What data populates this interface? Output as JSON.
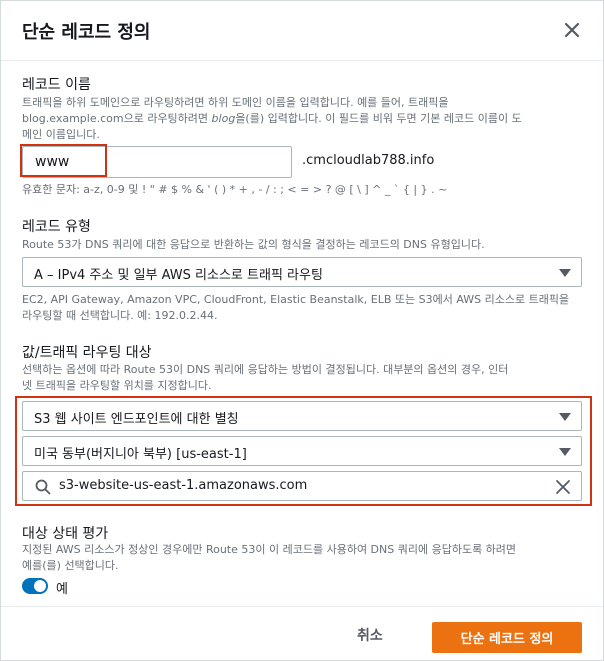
{
  "dialog": {
    "title": "단순 레코드 정의"
  },
  "record_name": {
    "label": "레코드 이름",
    "desc_line1": "트래픽을 하위 도메인으로 라우팅하려면 하위 도메인 이름을 입력합니다. 예를 들어, 트래픽을",
    "desc_line2_pre": "blog.example.com으로 라우팅하려면 ",
    "desc_line2_em": "blog",
    "desc_line2_post": "을(를) 입력합니다. 이 필드를 비워 두면 기본 레코드 이름이 도",
    "desc_line3": "메인 이름입니다.",
    "value": "www",
    "domain_suffix": ".cmcloudlab788.info",
    "valid_chars": "유효한 문자: a-z, 0-9 및 ! \" # $ % & ' ( ) * + , - / : ; < = > ? @ [ \\ ] ^ _ ` { | } . ~"
  },
  "record_type": {
    "label": "레코드 유형",
    "desc": "Route 53가 DNS 쿼리에 대한 응답으로 반환하는 값의 형식을 결정하는 레코드의 DNS 유형입니다.",
    "selected": "A – IPv4 주소 및 일부 AWS 리소스로 트래픽 라우팅",
    "hint_line1": "EC2, API Gateway, Amazon VPC, CloudFront, Elastic Beanstalk, ELB 또는 S3에서 AWS 리소스로 트래픽을",
    "hint_line2": "라우팅할 때 선택합니다. 예: 192.0.2.44."
  },
  "target": {
    "label": "값/트래픽 라우팅 대상",
    "desc_line1": "선택하는 옵션에 따라 Route 53이 DNS 쿼리에 응답하는 방법이 결정됩니다. 대부분의 옵션의 경우, 인터",
    "desc_line2": "넷 트래픽을 라우팅할 위치를 지정합니다.",
    "endpoint": "S3 웹 사이트 엔드포인트에 대한 별칭",
    "region": "미국 동부(버지니아 북부) [us-east-1]",
    "search_value": "s3-website-us-east-1.amazonaws.com"
  },
  "health": {
    "label": "대상 상태 평가",
    "desc_line1": "지정된 AWS 리소스가 정상인 경우에만 Route 53이 이 레코드를 사용하여 DNS 쿼리에 응답하도록 하려면",
    "desc_line2": "예를(를) 선택합니다.",
    "toggle_label": "예"
  },
  "footer": {
    "cancel_label": "취소",
    "submit_label": "단순 레코드 정의"
  },
  "colors": {
    "primary": "#ec7211",
    "toggle": "#0073bb",
    "highlight": "#d13212"
  }
}
